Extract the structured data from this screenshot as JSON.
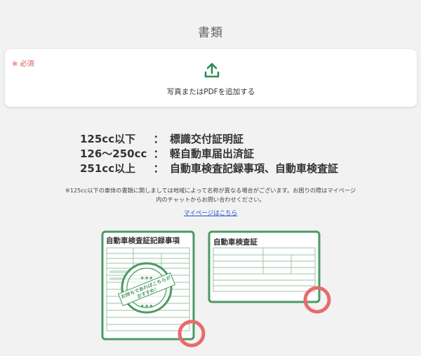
{
  "section": {
    "title": "書類"
  },
  "upload": {
    "required_label": "※ 必須",
    "button_text": "写真またはPDFを追加する",
    "icon": "upload-icon",
    "accent_color": "#2e8b57"
  },
  "rules": [
    {
      "cc": "125cc以下",
      "colon": "：",
      "doc": "標識交付証明証"
    },
    {
      "cc": "126〜250cc",
      "colon": "：",
      "doc": "軽自動車届出済証"
    },
    {
      "cc": "251cc以上",
      "colon": "：",
      "doc": "自動車検査記録事項、自動車検査証"
    }
  ],
  "note": "※125cc以下の車体の書類に関しましては地域によって名称が異なる場合がございます。お困りの際はマイページ内のチャットからお問い合わせください。",
  "mypage_link": "マイページはこちら",
  "illustration": {
    "doc1_title": "自動車検査証記録事項",
    "doc2_title": "自動車検査証",
    "stamp_text": "お持ちであればこちらがおすすめ！",
    "stamp_stars": "★★★",
    "frame_color": "#4a9a63",
    "marker_color": "#e86b6b"
  }
}
